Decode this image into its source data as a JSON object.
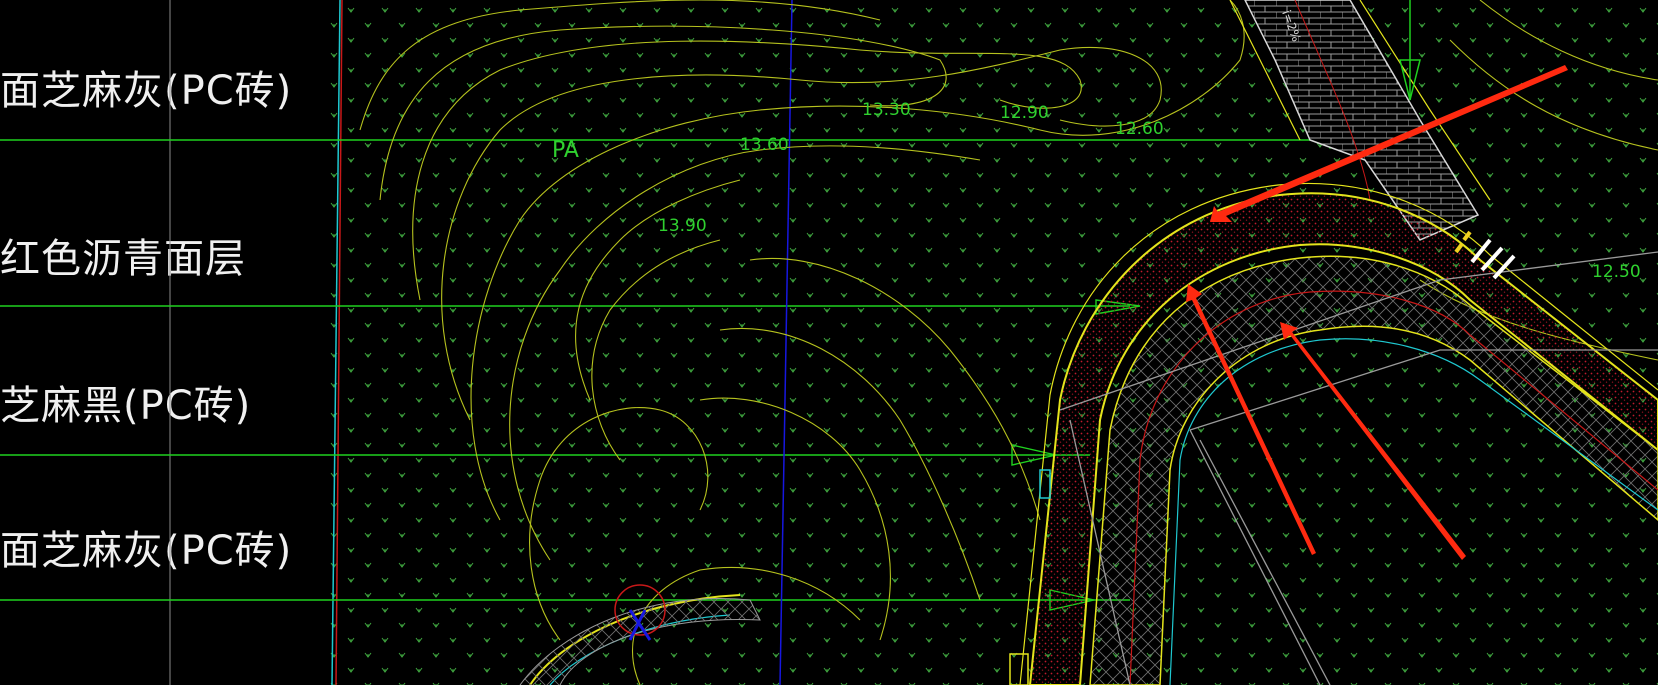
{
  "legend": {
    "rows": [
      {
        "label": "面芝麻灰(PC砖)"
      },
      {
        "label": "红色沥青面层"
      },
      {
        "label": "芝麻黑(PC砖)"
      },
      {
        "label": "面芝麻灰(PC砖)"
      }
    ]
  },
  "contours": [
    {
      "label": "13.30"
    },
    {
      "label": "12.90"
    },
    {
      "label": "12.60"
    },
    {
      "label": "13.60"
    },
    {
      "label": "13.90"
    },
    {
      "label": "12.50"
    }
  ],
  "area_tag": "PA",
  "slope_tag": "i=2%",
  "colors": {
    "background": "#000000",
    "grid_line": "#1fd11f",
    "contour": "#b6c21e",
    "grass_symbol": "#3fa63f",
    "path_edge": "#e4e41c",
    "asphalt_fill": "#b0142a",
    "annotation_arrow": "#ff2a10",
    "blue_line": "#1717e0",
    "cyan_line": "#1fc8d0"
  }
}
